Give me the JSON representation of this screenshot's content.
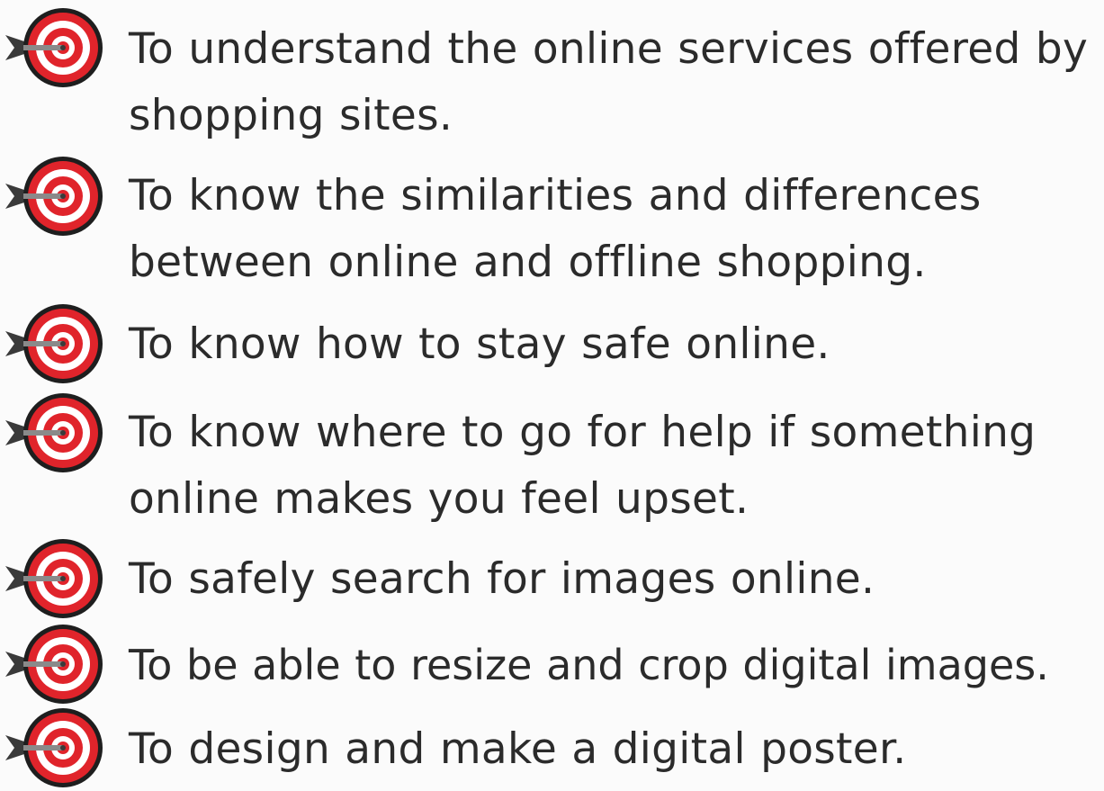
{
  "objectives": [
    "To understand the online services offered by shopping sites.",
    "To know the similarities and differences between online and offline shopping.",
    "To know how to stay safe online.",
    "To know where to go for help if something online makes you feel upset.",
    "To safely search for images online.",
    "To be able to resize and crop digital images.",
    "To design and make a digital poster."
  ],
  "colors": {
    "text": "#2b2b2b",
    "target_red": "#e0242b",
    "target_white": "#ffffff",
    "target_outline": "#1e1e1e",
    "dart": "#3a3a3a",
    "background": "#fbfbfb"
  },
  "icon": "target-dart-icon"
}
